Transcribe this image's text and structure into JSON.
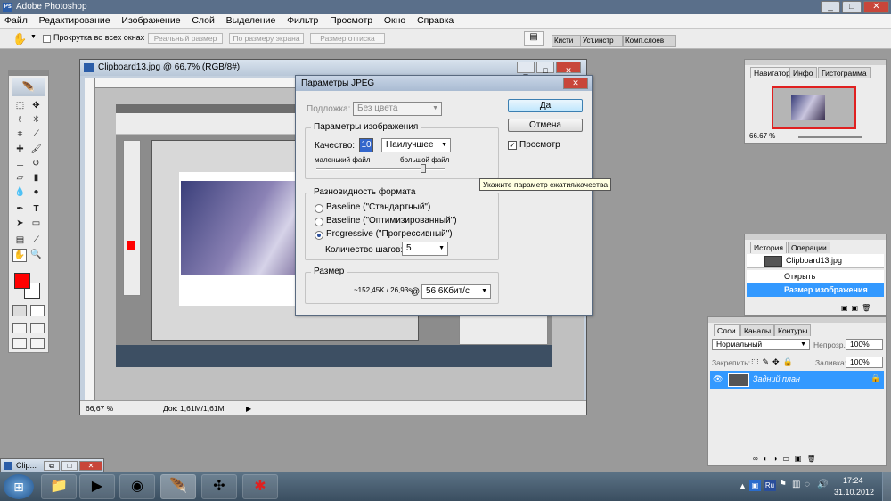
{
  "app": {
    "title": "Adobe Photoshop",
    "min": "_",
    "max": "□",
    "close": "✕"
  },
  "menu": [
    "Файл",
    "Редактирование",
    "Изображение",
    "Слой",
    "Выделение",
    "Фильтр",
    "Просмотр",
    "Окно",
    "Справка"
  ],
  "options": {
    "scroll_all": "Прокрутка во всех окнах",
    "btn_actual": "Реальный размер",
    "btn_fit": "По размеру экрана",
    "btn_print": "Размер оттиска",
    "tabs": [
      "Кисти",
      "Уст.инстр",
      "Комп.слоев"
    ]
  },
  "document": {
    "title": "Clipboard13.jpg @ 66,7% (RGB/8#)",
    "zoom": "66,67 %",
    "doc_info": "Док: 1,61M/1,61M"
  },
  "navigator": {
    "tabs": [
      "Навигатор",
      "Инфо",
      "Гистограмма"
    ],
    "zoom": "66.67 %"
  },
  "history": {
    "tabs": [
      "История",
      "Операции"
    ],
    "snapshot": "Clipboard13.jpg",
    "items": [
      "Открыть",
      "Размер изображения"
    ]
  },
  "layers": {
    "tabs": [
      "Слои",
      "Каналы",
      "Контуры"
    ],
    "blend_mode": "Нормальный",
    "opacity_label": "Непрозр.:",
    "opacity": "100%",
    "lock_label": "Закрепить:",
    "fill_label": "Заливка:",
    "fill": "100%",
    "layer_name": "Задний план"
  },
  "dialog": {
    "title": "Параметры JPEG",
    "matte_label": "Подложка:",
    "matte_value": "Без цвета",
    "image_options": "Параметры изображения",
    "quality_label": "Качество:",
    "quality_value": "10",
    "quality_preset": "Наилучшее",
    "small_file": "маленький файл",
    "large_file": "большой файл",
    "quality_fraction": 0.83,
    "format_options": "Разновидность формата",
    "baseline_std": "Baseline (\"Стандартный\")",
    "baseline_opt": "Baseline (\"Оптимизированный\")",
    "progressive": "Progressive (\"Прогрессивный\")",
    "scans_label": "Количество шагов:",
    "scans_value": "5",
    "size_group": "Размер",
    "size_value": "~152,45K / 26,93s",
    "at": "@",
    "speed": "56,6Кбит/с",
    "ok": "Да",
    "cancel": "Отмена",
    "preview": "Просмотр",
    "tooltip": "Укажите параметр сжатия/качества"
  },
  "minimized": {
    "label": "Clip..."
  },
  "taskbar": {
    "start": "⊞",
    "lang": "Ru",
    "time": "17:24",
    "date": "31.10.2012"
  }
}
